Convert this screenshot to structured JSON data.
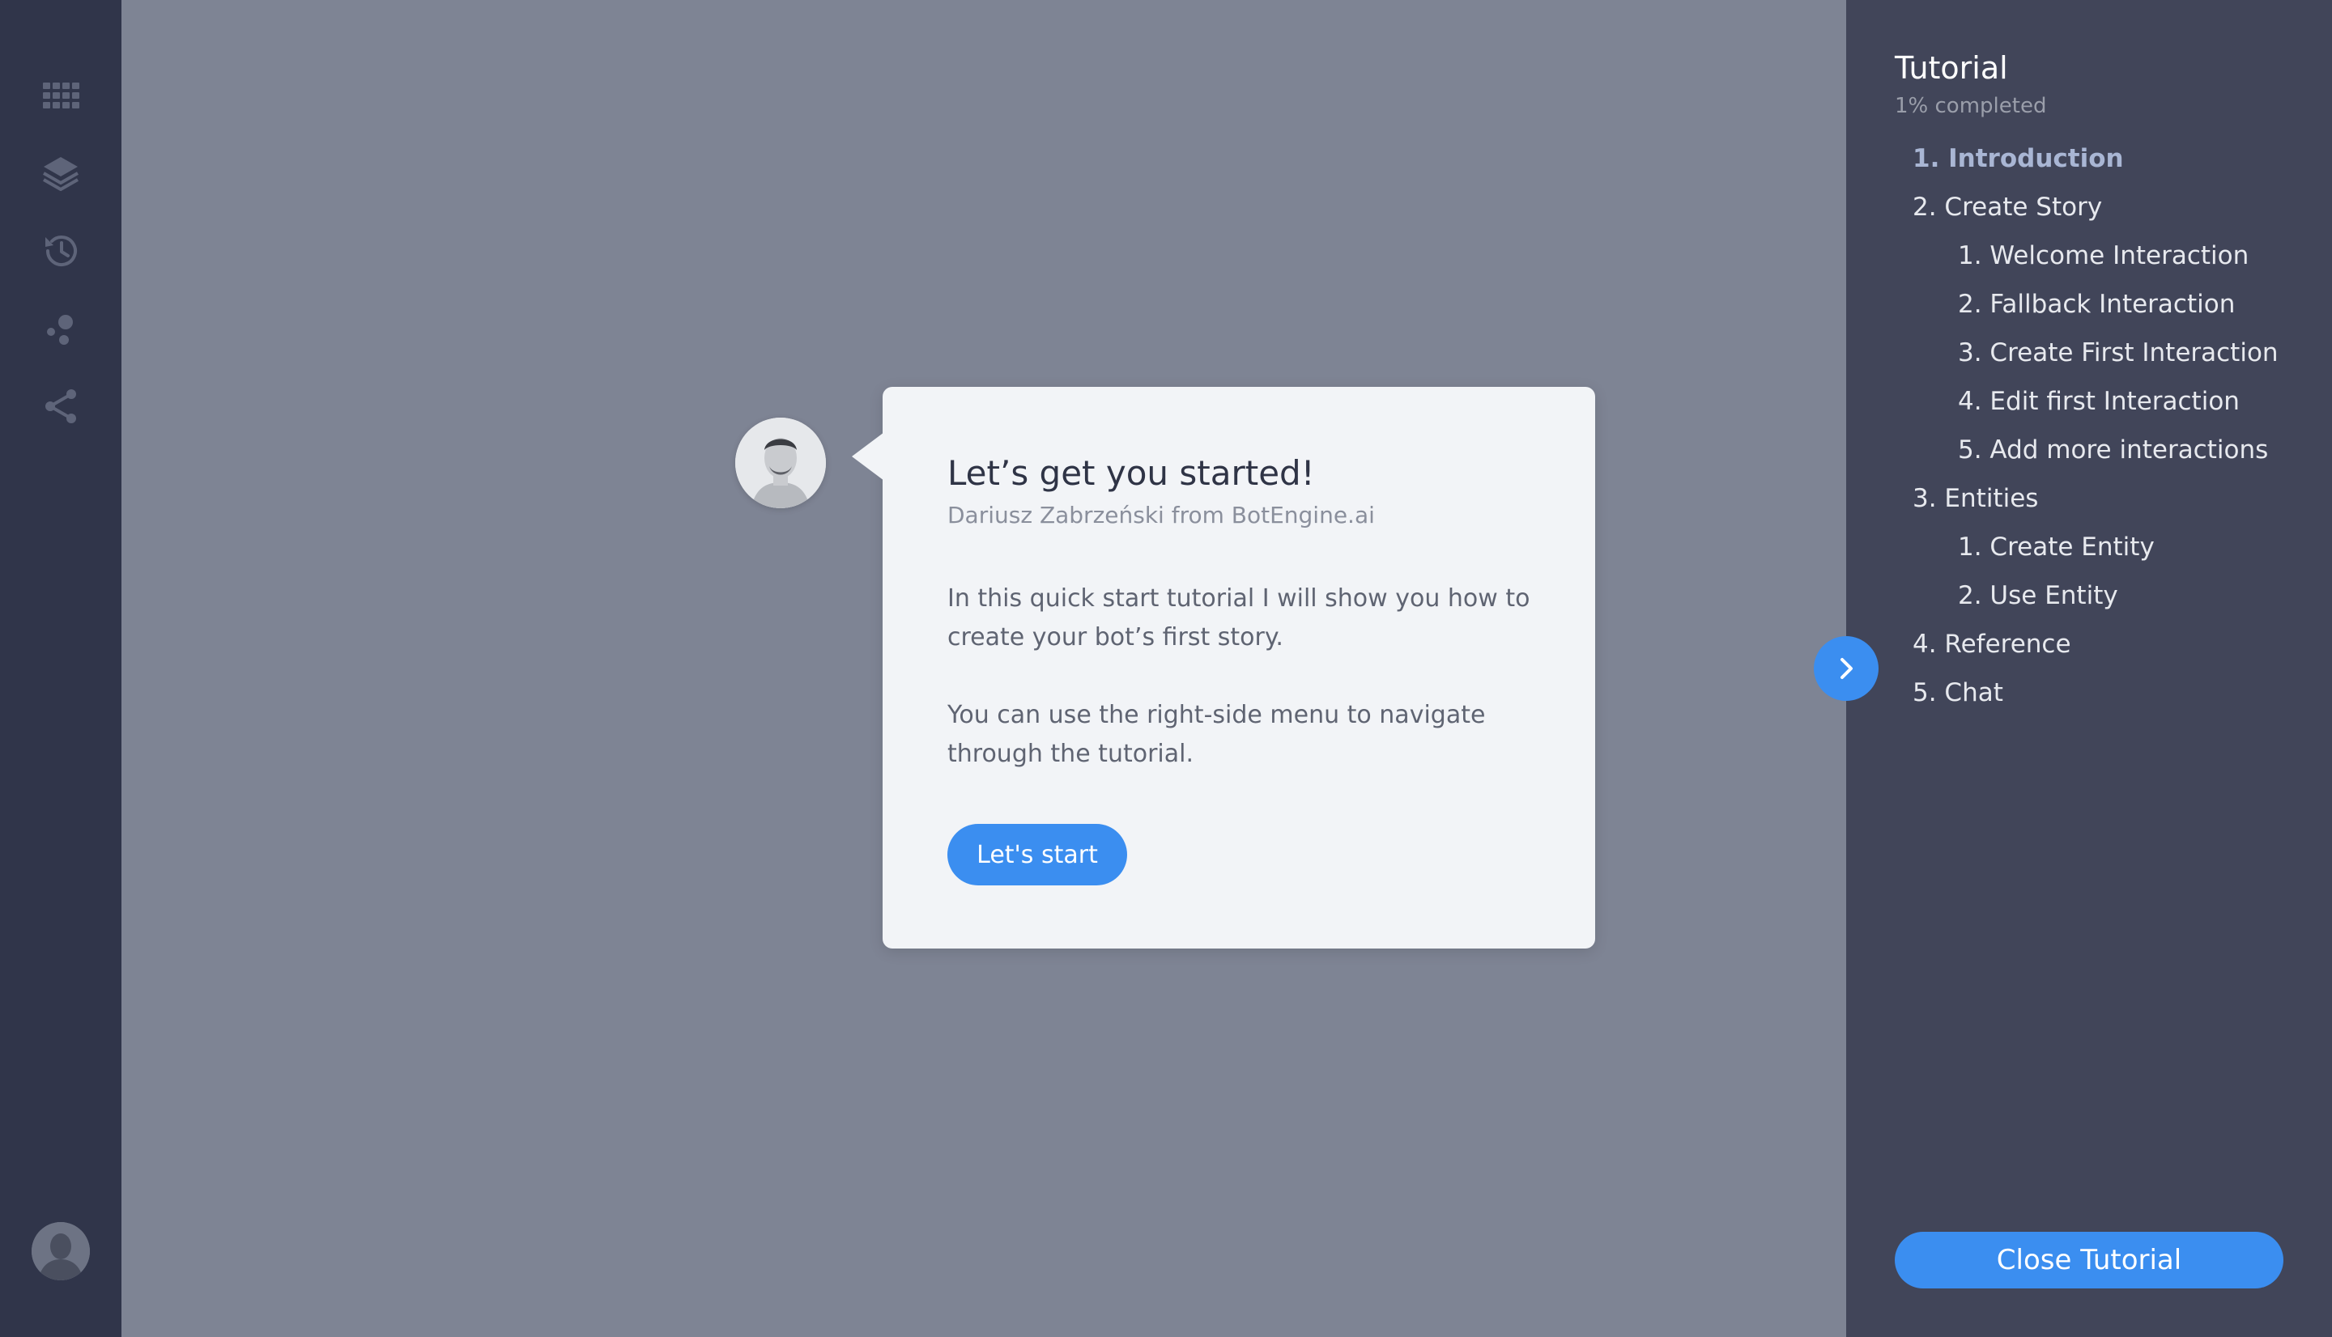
{
  "colors": {
    "accent": "#3b8ef0",
    "rail_bg": "#30354a",
    "main_bg": "#7e8494",
    "panel_bg": "#414559",
    "card_bg": "#f2f4f7",
    "active_toc": "#a9b6d4"
  },
  "rail": {
    "icons": [
      "grid-icon",
      "layers-icon",
      "history-icon",
      "training-icon",
      "share-icon"
    ],
    "user_avatar": "user-avatar"
  },
  "card": {
    "title": "Let’s get you started!",
    "subtitle": "Dariusz Zabrzeński from BotEngine.ai",
    "paragraph1": "In this quick start tutorial I will show you how to create your bot’s first story.",
    "paragraph2": "You can use the right-side menu to navigate through the tutorial.",
    "start_button": "Let's start"
  },
  "tutorial": {
    "title": "Tutorial",
    "progress": "1% completed",
    "items": [
      {
        "label": "1. Introduction",
        "level": 1,
        "active": true
      },
      {
        "label": "2. Create Story",
        "level": 1,
        "active": false
      },
      {
        "label": "1. Welcome Interaction",
        "level": 2,
        "active": false
      },
      {
        "label": "2. Fallback Interaction",
        "level": 2,
        "active": false
      },
      {
        "label": "3. Create First Interaction",
        "level": 2,
        "active": false
      },
      {
        "label": "4. Edit first Interaction",
        "level": 2,
        "active": false
      },
      {
        "label": "5. Add more interactions",
        "level": 2,
        "active": false
      },
      {
        "label": "3. Entities",
        "level": 1,
        "active": false
      },
      {
        "label": "1. Create Entity",
        "level": 2,
        "active": false
      },
      {
        "label": "2. Use Entity",
        "level": 2,
        "active": false
      },
      {
        "label": "4. Reference",
        "level": 1,
        "active": false
      },
      {
        "label": "5. Chat",
        "level": 1,
        "active": false
      }
    ],
    "close_button": "Close Tutorial"
  }
}
